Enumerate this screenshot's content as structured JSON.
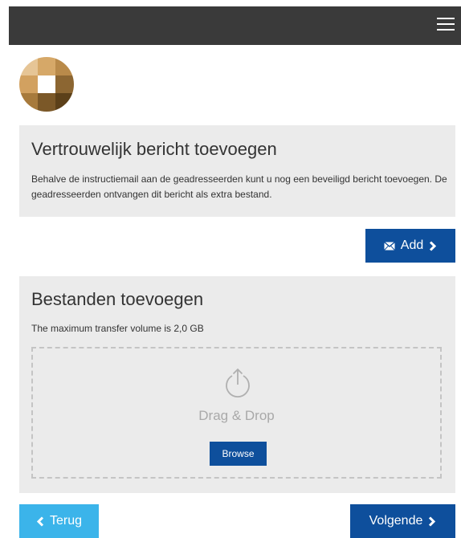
{
  "header": {
    "menu_icon": "hamburger-menu-icon"
  },
  "logo": {
    "icon": "square-mosaic-logo",
    "colors": [
      "#d9b07a",
      "#b8894c",
      "#7a5a2c",
      "#ffffff"
    ]
  },
  "message_panel": {
    "title": "Vertrouwelijk bericht toevoegen",
    "description": "Behalve de instructiemail aan de geadresseerden kunt u nog een beveiligd bericht toevoegen. De geadresseerden ontvangen dit bericht als extra bestand."
  },
  "add_button": {
    "label": "Add",
    "icon": "envelope-icon",
    "trailing_icon": "chevron-right-icon"
  },
  "files_panel": {
    "title": "Bestanden toevoegen",
    "max_volume": "The maximum transfer volume is 2,0 GB",
    "dropzone": {
      "icon": "upload-icon",
      "label": "Drag & Drop",
      "browse_label": "Browse"
    }
  },
  "footer": {
    "back_label": "Terug",
    "back_icon": "chevron-left-icon",
    "next_label": "Volgende",
    "next_icon": "chevron-right-icon"
  },
  "colors": {
    "header_bg": "#3a3a3a",
    "panel_bg": "#ebebeb",
    "primary": "#0e4f9c",
    "secondary": "#3bb4ea",
    "dropzone_border": "#c4c4c4"
  }
}
